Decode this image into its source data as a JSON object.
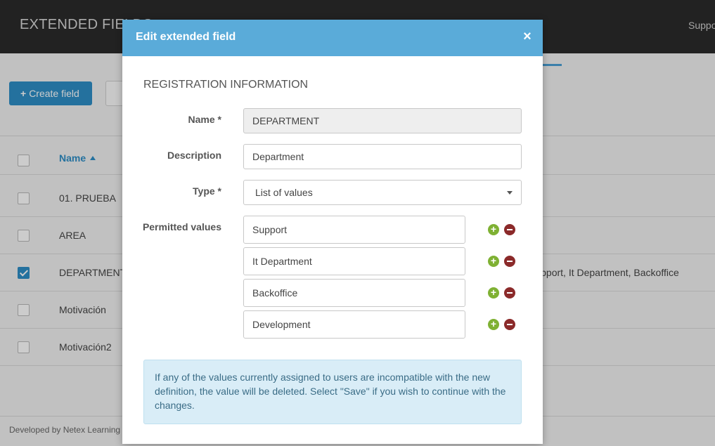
{
  "app": {
    "title": "EXTENDED FIELDS",
    "top_link": "Support"
  },
  "toolbar": {
    "create_label": "Create field"
  },
  "table": {
    "header_name": "Name",
    "rows": [
      {
        "name": "01. PRUEBA",
        "values": "",
        "checked": false
      },
      {
        "name": "AREA",
        "values": "",
        "checked": false
      },
      {
        "name": "DEPARTMENT",
        "values": "Support, It Department, Backoffice",
        "checked": true
      },
      {
        "name": "Motivación",
        "values": "",
        "checked": false
      },
      {
        "name": "Motivación2",
        "values": "",
        "checked": false
      }
    ]
  },
  "footer": {
    "text": "Developed by Netex Learning"
  },
  "modal": {
    "title": "Edit extended field",
    "close": "×",
    "section": "REGISTRATION INFORMATION",
    "name_label": "Name *",
    "name_value": "DEPARTMENT",
    "description_label": "Description",
    "description_value": "Department",
    "type_label": "Type *",
    "type_value": "List of values",
    "permitted_label": "Permitted values",
    "permitted_values": [
      "Support",
      "It Department",
      "Backoffice",
      "Development"
    ],
    "alert": "If any of the values currently assigned to users are incompatible with the new definition, the value will be deleted. Select \"Save\" if you wish to continue with the changes."
  },
  "colors": {
    "header": "#5aabd9",
    "primary": "#2e8ec6",
    "add": "#7fb133",
    "remove": "#8b2a2a",
    "alert_bg": "#d9edf7"
  }
}
